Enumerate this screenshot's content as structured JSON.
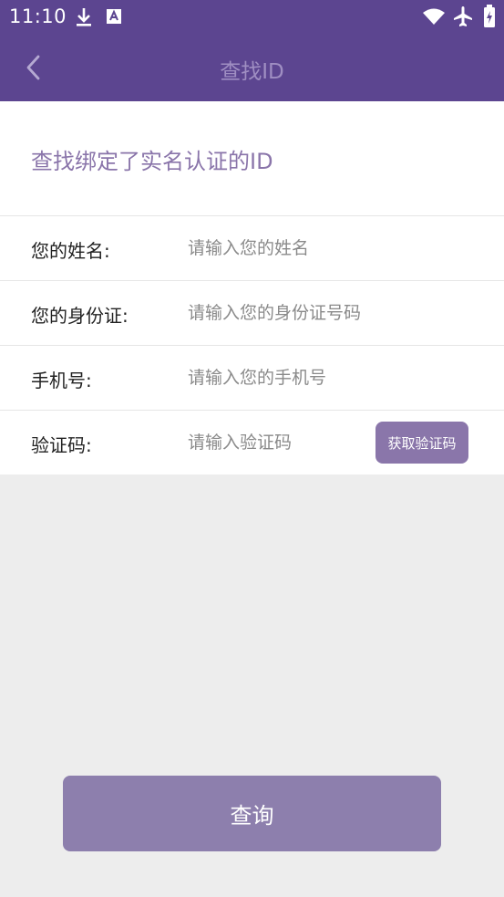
{
  "status_bar": {
    "time": "11:10",
    "icons": [
      "download-icon",
      "font-a-icon",
      "wifi-icon",
      "airplane-icon",
      "battery-icon"
    ]
  },
  "nav": {
    "back_icon": "chevron-left-icon",
    "title": "查找ID"
  },
  "header": {
    "text": "查找绑定了实名认证的ID"
  },
  "form": {
    "name": {
      "label": "您的姓名:",
      "placeholder": "请输入您的姓名"
    },
    "id_card": {
      "label": "您的身份证:",
      "placeholder": "请输入您的身份证号码"
    },
    "phone": {
      "label": "手机号:",
      "placeholder": "请输入您的手机号"
    },
    "code": {
      "label": "验证码:",
      "placeholder": "请输入验证码",
      "button": "获取验证码"
    }
  },
  "submit": {
    "label": "查询"
  },
  "colors": {
    "header_bg": "#5c4590",
    "accent": "#8a76aa",
    "page_bg": "#ededed"
  }
}
